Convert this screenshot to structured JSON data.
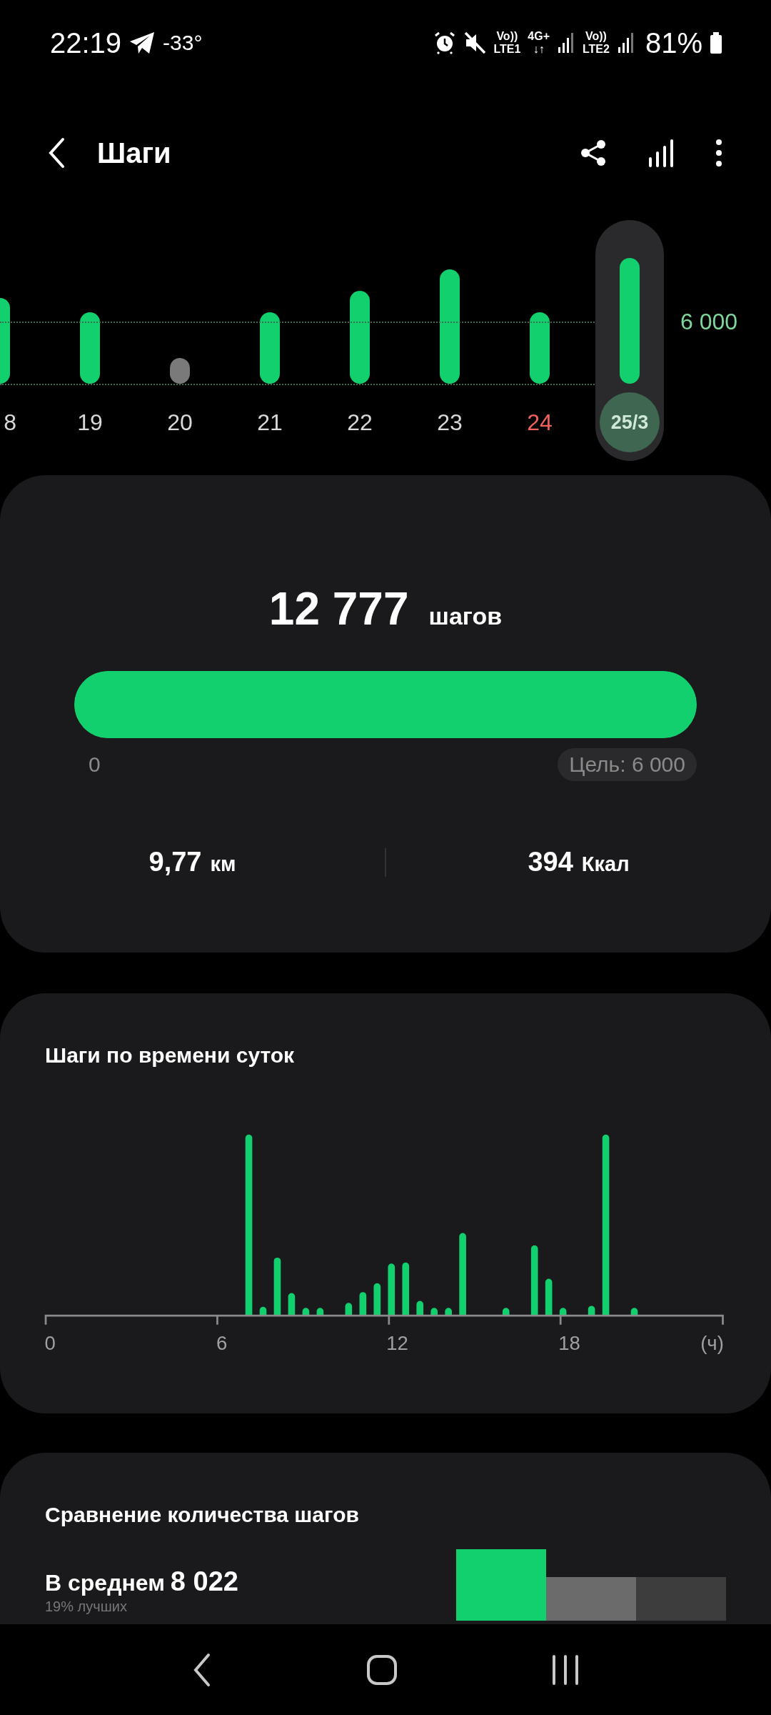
{
  "status_bar": {
    "time": "22:19",
    "temperature": "-33°",
    "networks": [
      {
        "top": "Vo))",
        "bottom": "LTE1"
      },
      {
        "top": "4G+",
        "bottom": "↓↑"
      },
      {
        "top": "Vo))",
        "bottom": "LTE2"
      }
    ],
    "battery": "81%"
  },
  "header": {
    "title": "Шаги"
  },
  "day_chart": {
    "goal_label": "6 000",
    "days": [
      {
        "label": "8",
        "active": true,
        "weekend": false,
        "selected": false
      },
      {
        "label": "19",
        "active": true,
        "weekend": false,
        "selected": false
      },
      {
        "label": "20",
        "active": false,
        "weekend": false,
        "selected": false
      },
      {
        "label": "21",
        "active": true,
        "weekend": false,
        "selected": false
      },
      {
        "label": "22",
        "active": true,
        "weekend": false,
        "selected": false
      },
      {
        "label": "23",
        "active": true,
        "weekend": false,
        "selected": false
      },
      {
        "label": "24",
        "active": true,
        "weekend": true,
        "selected": false
      },
      {
        "label": "25/3",
        "active": true,
        "weekend": false,
        "selected": true
      }
    ]
  },
  "summary": {
    "steps": "12 777",
    "unit": "шагов",
    "level": 1,
    "min_label": "0",
    "goal_label": "Цель: 6 000",
    "distance": {
      "value": "9,77",
      "unit": "км"
    },
    "calories": {
      "value": "394",
      "unit": "Ккал"
    }
  },
  "hourly": {
    "title": "Шаги по времени суток",
    "axis_labels": [
      "0",
      "6",
      "12",
      "18",
      "(ч)"
    ]
  },
  "comparison": {
    "title": "Сравнение количества шагов",
    "label": "В среднем",
    "value": "8 022",
    "note": "19% лучших"
  }
}
